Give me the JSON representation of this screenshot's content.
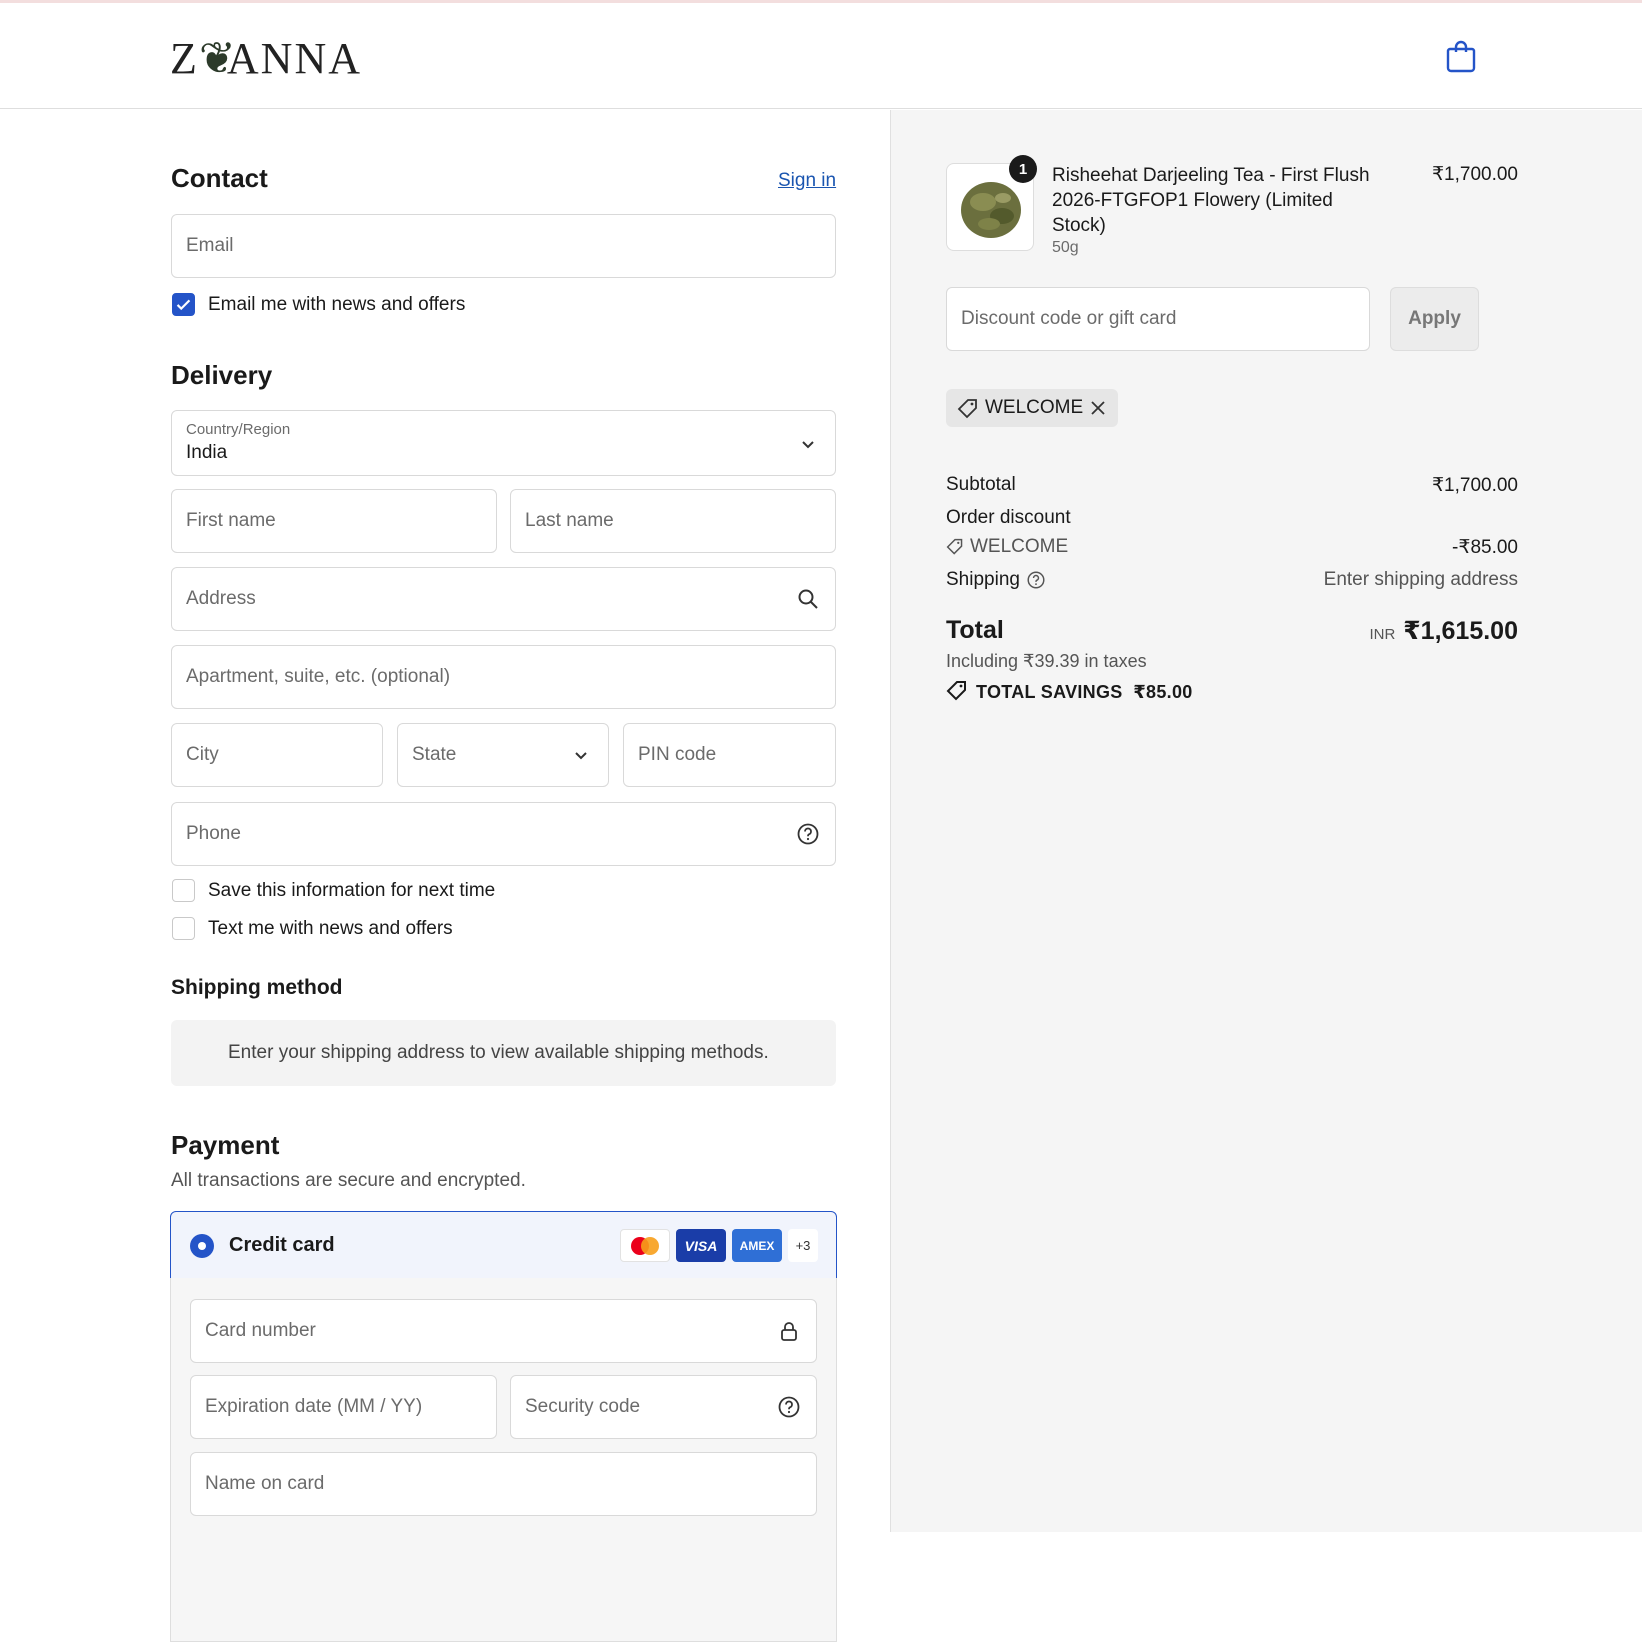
{
  "brand": {
    "logo_left": "Z",
    "logo_right": "ANNA",
    "logo_mark": "leaf-mark"
  },
  "contact": {
    "title": "Contact",
    "signin_label": "Sign in",
    "email_placeholder": "Email",
    "news_label": "Email me with news and offers",
    "news_checked": true
  },
  "delivery": {
    "title": "Delivery",
    "country_label": "Country/Region",
    "country_value": "India",
    "first_name_placeholder": "First name",
    "last_name_placeholder": "Last name",
    "address_placeholder": "Address",
    "apartment_placeholder": "Apartment, suite, etc. (optional)",
    "city_placeholder": "City",
    "state_placeholder": "State",
    "pin_placeholder": "PIN code",
    "phone_placeholder": "Phone",
    "save_info_label": "Save this information for next time",
    "text_news_label": "Text me with news and offers"
  },
  "shipping_method": {
    "title": "Shipping method",
    "message": "Enter your shipping address to view available shipping methods."
  },
  "payment": {
    "title": "Payment",
    "subtitle": "All transactions are secure and encrypted.",
    "method_label": "Credit card",
    "card_brands": [
      "mastercard",
      "VISA",
      "AMEX"
    ],
    "more_cards": "+3",
    "card_number_placeholder": "Card number",
    "expiry_placeholder": "Expiration date (MM / YY)",
    "security_placeholder": "Security code",
    "name_placeholder": "Name on card"
  },
  "summary": {
    "item": {
      "quantity": "1",
      "name": "Risheehat Darjeeling Tea - First Flush 2026-FTGFOP1 Flowery (Limited Stock)",
      "variant": "50g",
      "price": "₹1,700.00"
    },
    "discount_placeholder": "Discount code or gift card",
    "apply_label": "Apply",
    "applied_code": "WELCOME",
    "subtotal_label": "Subtotal",
    "subtotal_value": "₹1,700.00",
    "order_discount_label": "Order discount",
    "discount_code": "WELCOME",
    "discount_value": "-₹85.00",
    "shipping_label": "Shipping",
    "shipping_value": "Enter shipping address",
    "total_label": "Total",
    "currency": "INR",
    "total_value": "₹1,615.00",
    "taxes_note": "Including ₹39.39 in taxes",
    "savings_label": "TOTAL SAVINGS",
    "savings_value": "₹85.00"
  },
  "colors": {
    "accent": "#2454c8",
    "link": "#1a55b0",
    "summary_bg": "#f5f5f5"
  }
}
